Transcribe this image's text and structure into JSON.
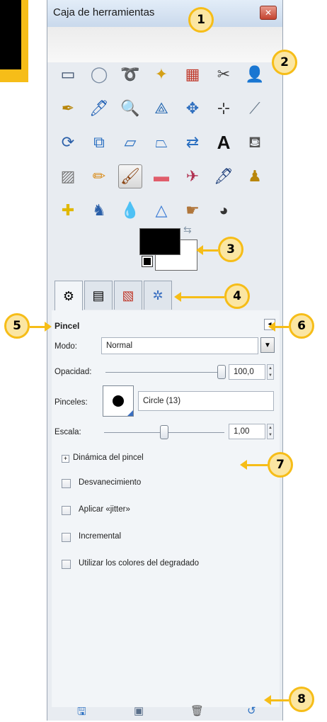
{
  "window": {
    "title": "Caja de herramientas",
    "close_label": "✕"
  },
  "tools": [
    {
      "name": "rect-select-tool",
      "glyph": "▭",
      "color": "#3b4f6b"
    },
    {
      "name": "ellipse-select-tool",
      "glyph": "◯",
      "color": "#7c8da3"
    },
    {
      "name": "free-select-tool",
      "glyph": "➰",
      "color": "#60738a"
    },
    {
      "name": "fuzzy-select-tool",
      "glyph": "✦",
      "color": "#d4a017"
    },
    {
      "name": "select-by-color-tool",
      "glyph": "▦",
      "color": "#c0392b"
    },
    {
      "name": "scissors-select-tool",
      "glyph": "✂",
      "color": "#444444"
    },
    {
      "name": "foreground-select-tool",
      "glyph": "👤",
      "color": "#2c5ea8"
    },
    {
      "name": "paths-tool",
      "glyph": "✒",
      "color": "#b8860b"
    },
    {
      "name": "color-picker-tool",
      "glyph": "🖊",
      "color": "#1f5fb4"
    },
    {
      "name": "zoom-tool",
      "glyph": "🔍",
      "color": "#1f5fb4"
    },
    {
      "name": "measure-tool",
      "glyph": "⟁",
      "color": "#2b6cb3"
    },
    {
      "name": "move-tool",
      "glyph": "✥",
      "color": "#2f6fbf"
    },
    {
      "name": "align-tool",
      "glyph": "⊹",
      "color": "#333333"
    },
    {
      "name": "crop-tool",
      "glyph": "⟋",
      "color": "#667788"
    },
    {
      "name": "rotate-tool",
      "glyph": "⟳",
      "color": "#2a5fa8"
    },
    {
      "name": "scale-tool",
      "glyph": "⧉",
      "color": "#2a6fc1"
    },
    {
      "name": "shear-tool",
      "glyph": "▱",
      "color": "#2a6fc1"
    },
    {
      "name": "perspective-tool",
      "glyph": "⏢",
      "color": "#2a6fc1"
    },
    {
      "name": "flip-tool",
      "glyph": "⇄",
      "color": "#2a6fc1"
    },
    {
      "name": "text-tool",
      "glyph": "A",
      "color": "#111111"
    },
    {
      "name": "bucket-fill-tool",
      "glyph": "⛾",
      "color": "#555555"
    },
    {
      "name": "blend-tool",
      "glyph": "▨",
      "color": "#777777"
    },
    {
      "name": "pencil-tool",
      "glyph": "✏",
      "color": "#d98c1a"
    },
    {
      "name": "paintbrush-tool",
      "glyph": "🖌",
      "color": "#8b4513"
    },
    {
      "name": "eraser-tool",
      "glyph": "▬",
      "color": "#e05d6b"
    },
    {
      "name": "airbrush-tool",
      "glyph": "✈",
      "color": "#b03050"
    },
    {
      "name": "ink-tool",
      "glyph": "🖋",
      "color": "#1e3f7a"
    },
    {
      "name": "clone-tool",
      "glyph": "♟",
      "color": "#b8860b"
    },
    {
      "name": "heal-tool",
      "glyph": "✚",
      "color": "#e0b800"
    },
    {
      "name": "perspective-clone-tool",
      "glyph": "♞",
      "color": "#2a5fa8"
    },
    {
      "name": "blur-tool",
      "glyph": "💧",
      "color": "#3a7bd5"
    },
    {
      "name": "sharpen-tool",
      "glyph": "△",
      "color": "#3a7bd5"
    },
    {
      "name": "smudge-tool",
      "glyph": "☛",
      "color": "#b0763b"
    },
    {
      "name": "dodge-burn-tool",
      "glyph": "◕",
      "color": "#333333"
    }
  ],
  "colors": {
    "foreground": "#000000",
    "background": "#ffffff",
    "swap_glyph": "⇆"
  },
  "tabs": [
    {
      "name": "tab-tool-options",
      "glyph": "⚙"
    },
    {
      "name": "tab-layers",
      "glyph": "▤"
    },
    {
      "name": "tab-channels",
      "glyph": "▧"
    },
    {
      "name": "tab-paths",
      "glyph": "✲"
    }
  ],
  "panel": {
    "title": "Pincel",
    "collapse_glyph": "◂",
    "mode": {
      "label": "Modo:",
      "value": "Normal"
    },
    "opacity": {
      "label": "Opacidad:",
      "value": "100,0",
      "fraction": 1.0
    },
    "brushes": {
      "label": "Pinceles:",
      "value": "Circle (13)"
    },
    "scale": {
      "label": "Escala:",
      "value": "1,00",
      "fraction": 0.5
    },
    "dynamics_label": "Dinámica del pincel",
    "checkboxes": [
      {
        "label": "Desvanecimiento"
      },
      {
        "label": "Aplicar «jitter»"
      },
      {
        "label": "Incremental"
      },
      {
        "label": "Utilizar los colores del degradado"
      }
    ]
  },
  "bottom_icons": [
    {
      "name": "save-options-icon",
      "glyph": "🖫",
      "color": "#2a6fc1"
    },
    {
      "name": "restore-options-icon",
      "glyph": "▣",
      "color": "#5a6f8a"
    },
    {
      "name": "delete-options-icon",
      "glyph": "🗑",
      "color": "#555555"
    },
    {
      "name": "reset-options-icon",
      "glyph": "↺",
      "color": "#2a6fc1"
    }
  ],
  "callouts": [
    "1",
    "2",
    "3",
    "4",
    "5",
    "6",
    "7",
    "8"
  ]
}
